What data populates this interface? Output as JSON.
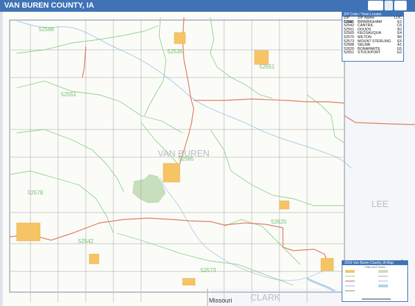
{
  "title": "VAN BUREN COUNTY, IA",
  "map": {
    "county_label": "VAN BUREN",
    "neighbor_counties": [
      {
        "id": "lee",
        "label": "LEE"
      },
      {
        "id": "clark",
        "label": "CLARK"
      }
    ],
    "river_label": "Missouri",
    "zip_labels": [
      {
        "id": "z52588",
        "label": "52588"
      },
      {
        "id": "z52535",
        "label": "52535"
      },
      {
        "id": "z52651",
        "label": "52651"
      },
      {
        "id": "z52551",
        "label": "52551"
      },
      {
        "id": "z52565",
        "label": "52565"
      },
      {
        "id": "z52578",
        "label": "52578"
      },
      {
        "id": "z52542",
        "label": "52542"
      },
      {
        "id": "z52620",
        "label": "52620"
      },
      {
        "id": "z52573",
        "label": "52573"
      }
    ]
  },
  "locator": {
    "heading": "ZIP Code / Town Locator",
    "columns": [
      "ZIP Code",
      "ZIP Name",
      "LOC"
    ],
    "rows": [
      {
        "zip": "52535",
        "name": "BIRMINGHAM",
        "loc": "E2"
      },
      {
        "zip": "52542",
        "name": "CANTRIL",
        "loc": "C6"
      },
      {
        "zip": "52551",
        "name": "DOUDS",
        "loc": "B2"
      },
      {
        "zip": "52565",
        "name": "KEOSAUQUA",
        "loc": "E4"
      },
      {
        "zip": "52570",
        "name": "MILTON",
        "loc": "B6"
      },
      {
        "zip": "52573",
        "name": "MOUNT STERLING",
        "loc": "E5"
      },
      {
        "zip": "52588",
        "name": "SELMA",
        "loc": "A1"
      },
      {
        "zip": "52620",
        "name": "BONAPARTE",
        "loc": "G5"
      },
      {
        "zip": "52651",
        "name": "STOCKPORT",
        "loc": "G2"
      }
    ]
  },
  "legend": {
    "heading": "2016 Van Buren County, IA Map",
    "caption": "Cities and Towns"
  },
  "colors": {
    "title_bar": "#3f73b6",
    "zip_boundary": "#8ad08a",
    "highway": "#e07a5f",
    "road": "#8c8c8c",
    "county_boundary": "#b9c2cc",
    "urban": "#f7c465",
    "park": "#c8dfbd",
    "water": "#b3d1ee"
  }
}
